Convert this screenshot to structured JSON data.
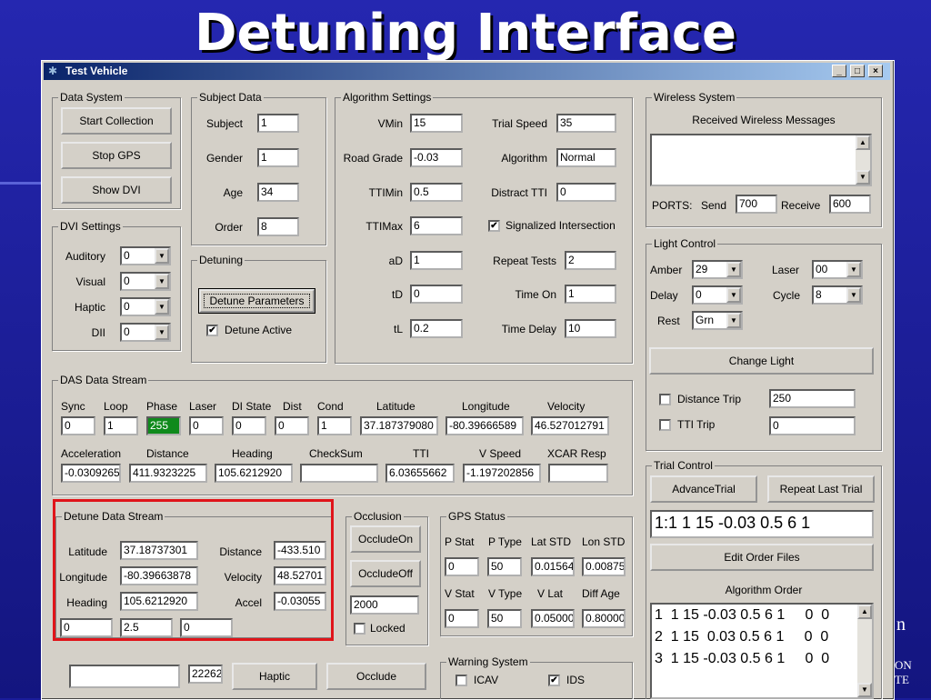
{
  "slide": {
    "title": "Detuning Interface",
    "bg_right_1": "n",
    "bg_right_2": "ON",
    "bg_right_3": "TE"
  },
  "window": {
    "title": "Test Vehicle",
    "min": "_",
    "max": "□",
    "close": "×"
  },
  "data_system": {
    "legend": "Data System",
    "start": "Start Collection",
    "stop": "Stop GPS",
    "show": "Show DVI"
  },
  "subject_data": {
    "legend": "Subject Data",
    "subject_label": "Subject",
    "subject": "1",
    "gender_label": "Gender",
    "gender": "1",
    "age_label": "Age",
    "age": "34",
    "order_label": "Order",
    "order": "8"
  },
  "algorithm": {
    "legend": "Algorithm Settings",
    "vmin_label": "VMin",
    "vmin": "15",
    "road_label": "Road Grade",
    "road": "-0.03",
    "ttimin_label": "TTIMin",
    "ttimin": "0.5",
    "ttimax_label": "TTIMax",
    "ttimax": "6",
    "ad_label": "aD",
    "ad": "1",
    "td_label": "tD",
    "td": "0",
    "tl_label": "tL",
    "tl": "0.2",
    "trial_speed_label": "Trial Speed",
    "trial_speed": "35",
    "algo_label": "Algorithm",
    "algo": "Normal",
    "distract_label": "Distract TTI",
    "distract": "0",
    "signalized_label": "Signalized Intersection",
    "repeat_label": "Repeat Tests",
    "repeat": "2",
    "timeon_label": "Time On",
    "timeon": "1",
    "timedelay_label": "Time Delay",
    "timedelay": "10"
  },
  "dvi": {
    "legend": "DVI Settings",
    "auditory_label": "Auditory",
    "auditory": "0",
    "visual_label": "Visual",
    "visual": "0",
    "haptic_label": "Haptic",
    "haptic": "0",
    "dii_label": "DII",
    "dii": "0"
  },
  "detuning": {
    "legend": "Detuning",
    "button": "Detune Parameters",
    "active_label": "Detune Active"
  },
  "wireless": {
    "legend": "Wireless System",
    "received_label": "Received Wireless Messages",
    "ports_label": "PORTS:",
    "send_label": "Send",
    "send": "700",
    "receive_label": "Receive",
    "receive": "600"
  },
  "light": {
    "legend": "Light Control",
    "amber_label": "Amber",
    "amber": "29",
    "laser_label": "Laser",
    "laser": "00",
    "delay_label": "Delay",
    "delay": "0",
    "cycle_label": "Cycle",
    "cycle": "8",
    "rest_label": "Rest",
    "rest": "Grn",
    "change": "Change Light",
    "distance_trip_label": "Distance Trip",
    "distance_trip": "250",
    "tti_trip_label": "TTI Trip",
    "tti_trip": "0"
  },
  "das": {
    "legend": "DAS Data Stream",
    "h1": [
      "Sync",
      "Loop",
      "Phase",
      "Laser",
      "DI State",
      "Dist",
      "Cond",
      "Latitude",
      "Longitude",
      "Velocity"
    ],
    "v1": [
      "0",
      "1",
      "255",
      "0",
      "0",
      "0",
      "1",
      "37.187379080",
      "-80.39666589",
      "46.527012791"
    ],
    "h2": [
      "Acceleration",
      "Distance",
      "Heading",
      "CheckSum",
      "TTI",
      "V Speed",
      "XCAR Resp"
    ],
    "v2": [
      "-0.0309265",
      "411.9323225",
      "105.6212920",
      "",
      "6.03655662",
      "-1.197202856",
      ""
    ],
    "phase_color": "#0f8a1c"
  },
  "detune_stream": {
    "legend": "Detune Data Stream",
    "lat_label": "Latitude",
    "lat": "37.18737301",
    "lon_label": "Longitude",
    "lon": "-80.39663878",
    "head_label": "Heading",
    "head": "105.6212920",
    "dist_label": "Distance",
    "dist": "-433.510",
    "vel_label": "Velocity",
    "vel": "48.52701",
    "accel_label": "Accel",
    "accel": "-0.03055",
    "b1": "0",
    "b2": "2.5",
    "b3": "0"
  },
  "occlusion": {
    "legend": "Occlusion",
    "on": "OccludeOn",
    "off": "OccludeOff",
    "value": "2000",
    "locked_label": "Locked"
  },
  "gps": {
    "legend": "GPS Status",
    "h1": [
      "P Stat",
      "P Type",
      "Lat STD",
      "Lon STD"
    ],
    "v1": [
      "0",
      "50",
      "0.01564",
      "0.00875"
    ],
    "h2": [
      "V Stat",
      "V Type",
      "V Lat",
      "Diff Age"
    ],
    "v2": [
      "0",
      "50",
      "0.05000",
      "0.80000"
    ]
  },
  "trial": {
    "legend": "Trial Control",
    "advance": "AdvanceTrial",
    "repeat_last": "Repeat Last Trial",
    "current": "1:1  1 15 -0.03 0.5 6 1",
    "edit": "Edit Order Files",
    "order_label": "Algorithm Order",
    "order_rows": [
      "1  1 15 -0.03 0.5 6 1     0  0",
      "2  1 15  0.03 0.5 6 1     0  0",
      "3  1 15 -0.03 0.5 6 1     0  0"
    ]
  },
  "bottom": {
    "field1": "",
    "field2": "22262",
    "haptic": "Haptic",
    "occlude": "Occlude"
  },
  "warning": {
    "legend": "Warning System",
    "icav_label": "ICAV",
    "ids_label": "IDS"
  },
  "check_mark": "✔"
}
